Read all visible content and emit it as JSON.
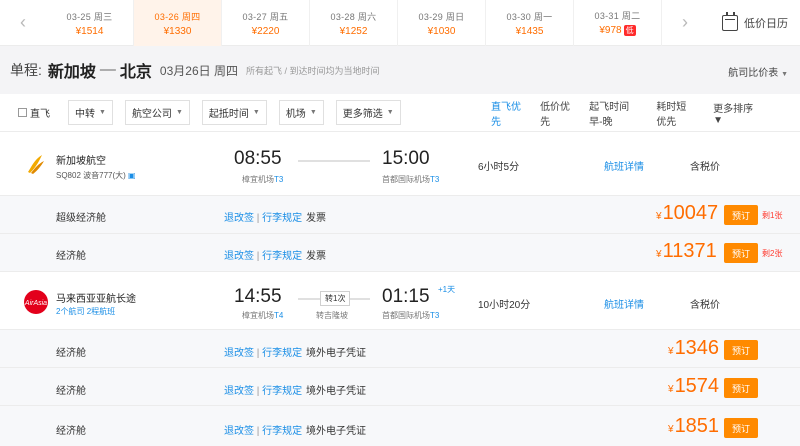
{
  "date_strip": {
    "dates": [
      {
        "date": "03-25",
        "weekday": "周三",
        "price": "¥1514",
        "active": false
      },
      {
        "date": "03-26",
        "weekday": "周四",
        "price": "¥1330",
        "active": true
      },
      {
        "date": "03-27",
        "weekday": "周五",
        "price": "¥2220",
        "active": false
      },
      {
        "date": "03-28",
        "weekday": "周六",
        "price": "¥1252",
        "active": false
      },
      {
        "date": "03-29",
        "weekday": "周日",
        "price": "¥1030",
        "active": false
      },
      {
        "date": "03-30",
        "weekday": "周一",
        "price": "¥1435",
        "active": false
      },
      {
        "date": "03-31",
        "weekday": "周二",
        "price": "¥978",
        "active": false,
        "badge": "低"
      }
    ],
    "calendar_label": "低价日历"
  },
  "route": {
    "trip_type": "单程:",
    "from": "新加坡",
    "to": "北京",
    "date": "03月26日 周四",
    "note": "所有起飞 / 到达时间均为当地时间",
    "compare_label": "航司比价表"
  },
  "filters": {
    "direct_label": "直飞",
    "dropdowns": [
      "中转",
      "航空公司",
      "起抵时间",
      "机场",
      "更多筛选"
    ],
    "sorts": [
      {
        "label": "直飞优先",
        "active": true
      },
      {
        "label": "低价优先",
        "active": false
      },
      {
        "label": "起飞时间早-晚",
        "active": false
      },
      {
        "label": "耗时短优先",
        "active": false
      },
      {
        "label": "更多排序",
        "active": false
      }
    ]
  },
  "flights": [
    {
      "airline": "新加坡航空",
      "flight_info": "SQ802 波音777(大)",
      "dep_time": "08:55",
      "dep_airport": "樟宜机场",
      "dep_terminal": "T3",
      "arr_time": "15:00",
      "arr_airport": "首都国际机场",
      "arr_terminal": "T3",
      "duration": "6小时5分",
      "detail_link": "航班详情",
      "tax_label": "含税价",
      "cabins": [
        {
          "name": "超级经济舱",
          "change_rules": "退改签",
          "baggage_rules": "行李规定",
          "ticket": "发票",
          "price": "10047",
          "book": "预订",
          "seats": "剩1张"
        },
        {
          "name": "经济舱",
          "change_rules": "退改签",
          "baggage_rules": "行李规定",
          "ticket": "发票",
          "price": "11371",
          "book": "预订",
          "seats": "剩2张"
        }
      ]
    },
    {
      "airline": "马来西亚亚航长途",
      "links": [
        "2个航司",
        "2程航班"
      ],
      "dep_time": "14:55",
      "dep_airport": "樟宜机场",
      "dep_terminal": "T4",
      "stop_badge": "转1次",
      "stop_city": "转吉隆坡",
      "arr_time": "01:15",
      "arr_day_offset": "+1天",
      "arr_airport": "首都国际机场",
      "arr_terminal": "T3",
      "duration": "10小时20分",
      "detail_link": "航班详情",
      "tax_label": "含税价",
      "cabins": [
        {
          "name": "经济舱",
          "change_rules": "退改签",
          "baggage_rules": "行李规定",
          "ticket": "境外电子凭证",
          "price": "1346",
          "book": "预订"
        },
        {
          "name": "经济舱",
          "change_rules": "退改签",
          "baggage_rules": "行李规定",
          "ticket": "境外电子凭证",
          "price": "1574",
          "book": "预订"
        },
        {
          "name": "经济舱",
          "change_rules": "退改签",
          "baggage_rules": "行李规定",
          "ticket": "境外电子凭证",
          "price": "1851",
          "book": "预订"
        }
      ]
    }
  ],
  "colors": {
    "accent": "#ff6d00",
    "link": "#1a8ee6",
    "book": "#ff8a00",
    "alert": "#ff3b30"
  },
  "icons": {
    "prev": "chevron-left-icon",
    "next": "chevron-right-icon",
    "calendar": "calendar-icon",
    "airline_sq": "singapore-airlines-logo",
    "airline_ak": "airasia-logo"
  }
}
